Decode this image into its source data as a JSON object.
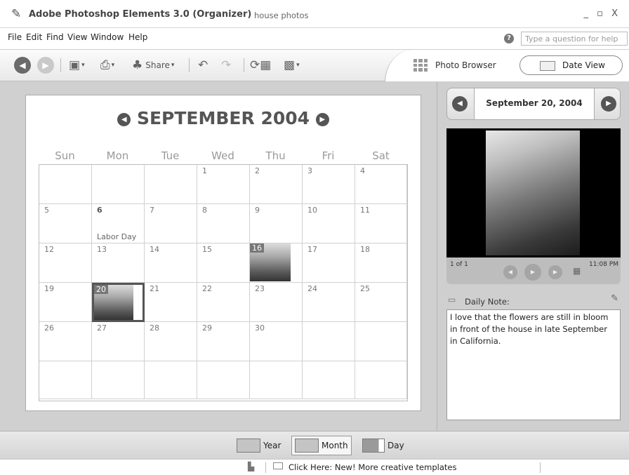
{
  "window": {
    "title": "Adobe Photoshop Elements 3.0 (Organizer)",
    "subtitle": "house photos",
    "controls": "_ ▫ X"
  },
  "menu": {
    "items": [
      "File",
      "Edit",
      "Find",
      "View",
      "Window",
      "Help"
    ],
    "help_placeholder": "Type a question for help"
  },
  "toolbar": {
    "share_label": "Share",
    "photo_browser_label": "Photo Browser",
    "date_view_label": "Date View"
  },
  "calendar": {
    "month_title": "SEPTEMBER 2004",
    "weekdays": [
      "Sun",
      "Mon",
      "Tue",
      "Wed",
      "Thu",
      "Fri",
      "Sat"
    ],
    "weeks": [
      [
        "",
        "",
        "",
        "1",
        "2",
        "3",
        "4"
      ],
      [
        "5",
        "6",
        "7",
        "8",
        "9",
        "10",
        "11"
      ],
      [
        "12",
        "13",
        "14",
        "15",
        "16",
        "17",
        "18"
      ],
      [
        "19",
        "20",
        "21",
        "22",
        "23",
        "24",
        "25"
      ],
      [
        "26",
        "27",
        "28",
        "29",
        "30",
        "",
        ""
      ],
      [
        "",
        "",
        "",
        "",
        "",
        "",
        ""
      ]
    ],
    "holiday": {
      "day": "6",
      "label": "Labor Day"
    },
    "photo_days": [
      "16",
      "20"
    ],
    "selected_day": "20"
  },
  "right_panel": {
    "date_label": "September 20, 2004",
    "count": "1 of 1",
    "time": "11:08 PM",
    "note_label": "Daily Note:",
    "note_text": "I love that the flowers are still in bloom in front of the house in late September in California."
  },
  "view_switch": {
    "year_label": "Year",
    "month_label": "Month",
    "day_label": "Day",
    "active": "Month"
  },
  "status": {
    "text": "Click Here: New! More creative templates"
  },
  "colors": {
    "panel_bg": "#d0d0d0",
    "nav_dark": "#555555"
  }
}
